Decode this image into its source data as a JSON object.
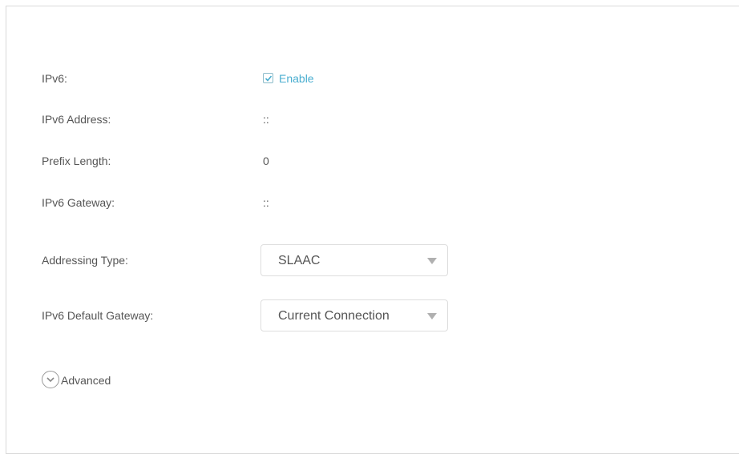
{
  "ipv6": {
    "label": "IPv6:",
    "enable_label": "Enable",
    "enabled": true
  },
  "ipv6_address": {
    "label": "IPv6 Address:",
    "value": "::"
  },
  "prefix_length": {
    "label": "Prefix Length:",
    "value": "0"
  },
  "ipv6_gateway": {
    "label": "IPv6 Gateway:",
    "value": "::"
  },
  "addressing_type": {
    "label": "Addressing Type:",
    "selected": "SLAAC"
  },
  "default_gateway": {
    "label": "IPv6 Default Gateway:",
    "selected": "Current Connection"
  },
  "advanced": {
    "label": "Advanced"
  },
  "colors": {
    "accent": "#4aaed0",
    "text": "#555555",
    "border": "#dedede"
  },
  "icons": {
    "checkbox": "checkmark-icon",
    "dropdown": "triangle-down-icon",
    "advanced": "chevron-down-circle-icon"
  }
}
